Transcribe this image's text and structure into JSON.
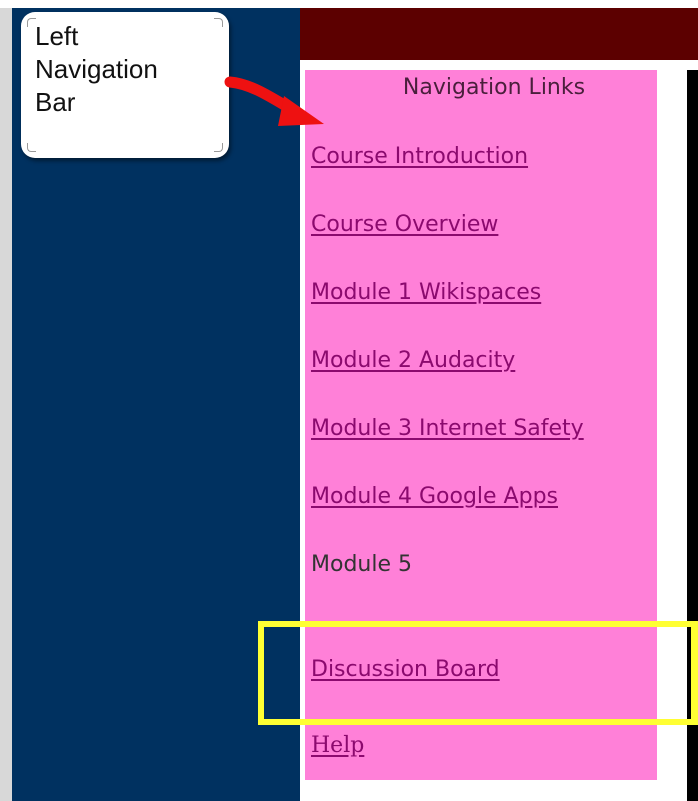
{
  "callout": {
    "text": "Left\nNavigation\nBar"
  },
  "nav_panel": {
    "heading": "Navigation Links",
    "items": [
      {
        "label": "Course Introduction",
        "is_link": true
      },
      {
        "label": "Course Overview",
        "is_link": true
      },
      {
        "label": "Module 1 Wikispaces",
        "is_link": true
      },
      {
        "label": "Module 2 Audacity",
        "is_link": true
      },
      {
        "label": "Module 3 Internet Safety",
        "is_link": true
      },
      {
        "label": "Module 4 Google Apps",
        "is_link": true
      },
      {
        "label": "Module 5",
        "is_link": false
      },
      {
        "label": "Discussion Board",
        "is_link": true
      },
      {
        "label": "Help",
        "is_link": true
      }
    ]
  },
  "colors": {
    "left_nav_bar": "#003160",
    "header_bar": "#5c0000",
    "nav_panel": "#ff80d8",
    "link": "#8b0a6e",
    "highlight": "#ffff33",
    "arrow": "#ee1111"
  }
}
